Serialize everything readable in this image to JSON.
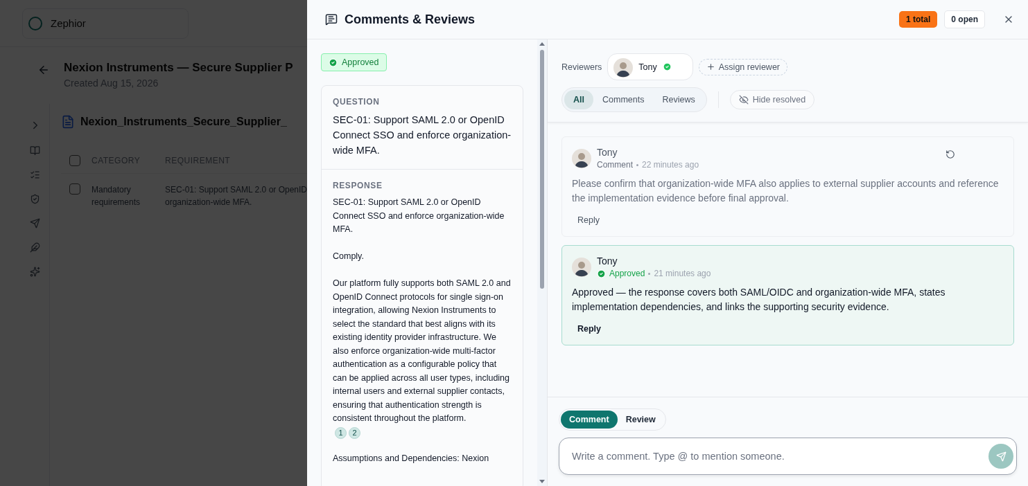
{
  "app": {
    "brand": "Zephior"
  },
  "page": {
    "title": "Nexion Instruments — Secure Supplier P",
    "created": "Created Aug 15, 2026",
    "document": "Nexion_Instruments_Secure_Supplier_",
    "header_checked": false,
    "columns": [
      "CATEGORY",
      "REQUIREMENT"
    ],
    "rows": [
      {
        "checked": false,
        "category": "Mandatory requirements",
        "requirement": [
          "SEC-01: Support SAML 2.0 or OpenID",
          "organization-wide MFA."
        ]
      }
    ]
  },
  "drawer": {
    "title": "Comments & Reviews",
    "total": "1 total",
    "open": "0 open"
  },
  "status": {
    "kind": "approved",
    "label": "Approved"
  },
  "question": {
    "label": "QUESTION",
    "text": "SEC-01: Support SAML 2.0 or OpenID Connect SSO and enforce organization-wide MFA."
  },
  "response": {
    "label": "RESPONSE",
    "paragraphs": [
      {
        "text": "SEC-01: Support SAML 2.0 or OpenID Connect SSO and enforce organization-wide MFA."
      },
      {
        "text": "Comply."
      },
      {
        "text": "Our platform fully supports both SAML 2.0 and OpenID Connect protocols for single sign-on integration, allowing Nexion Instruments to select the standard that best aligns with its existing identity provider infrastructure. We also enforce organization-wide multi-factor authentication as a configurable policy that can be applied across all user types, including internal users and external supplier contacts, ensuring that authentication strength is consistent throughout the platform.",
        "citations": [
          "1",
          "2"
        ]
      },
      {
        "text": "Assumptions and Dependencies: Nexion"
      }
    ]
  },
  "reviewers": {
    "label": "Reviewers",
    "people": [
      {
        "name": "Tony",
        "approved": true
      }
    ],
    "assign": "Assign reviewer"
  },
  "filters": [
    {
      "label": "All",
      "selected": true
    },
    {
      "label": "Comments",
      "selected": false
    },
    {
      "label": "Reviews",
      "selected": false
    }
  ],
  "hide_resolved": "Hide resolved",
  "comments": [
    {
      "kind": "comment",
      "author": "Tony",
      "type_label": "Comment",
      "time": "22 minutes ago",
      "resolved": true,
      "text": "Please confirm that organization-wide MFA also applies to external supplier accounts and reference the implementation evidence before final approval.",
      "reply": "Reply"
    },
    {
      "kind": "approval",
      "author": "Tony",
      "type_label": "Approved",
      "time": "21 minutes ago",
      "resolved": false,
      "text": "Approved — the response covers both SAML/OIDC and organization-wide MFA, states implementation dependencies, and links the supporting security evidence.",
      "reply": "Reply"
    }
  ],
  "composer": {
    "modes": [
      {
        "label": "Comment",
        "selected": true
      },
      {
        "label": "Review",
        "selected": false
      }
    ],
    "placeholder": "Write a comment. Type @ to mention someone."
  }
}
